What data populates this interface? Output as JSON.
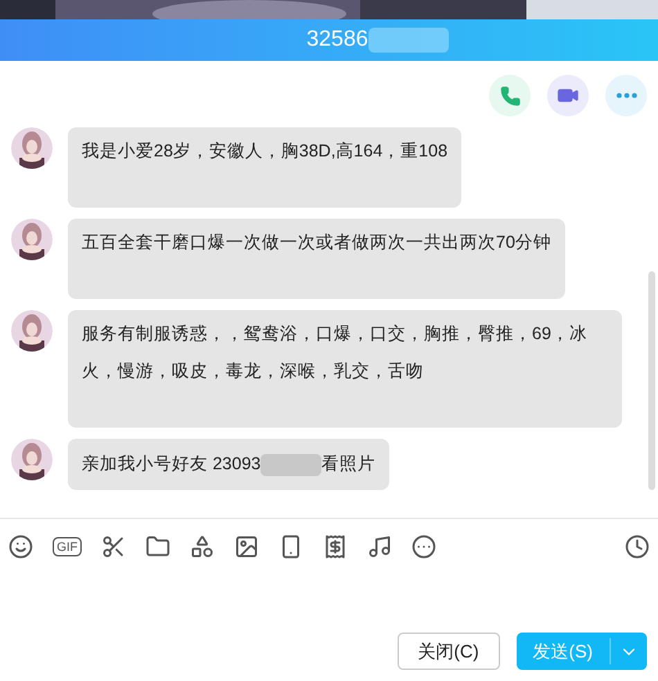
{
  "header": {
    "title": "32586"
  },
  "messages": [
    {
      "parts": [
        "我是小爱28岁，安徽人，胸38D,高164，重108"
      ],
      "redacted": false
    },
    {
      "parts": [
        "五百全套干磨口爆一次做一次或者做两次一共出两次70分钟"
      ],
      "redacted": false
    },
    {
      "parts": [
        "服务有制服诱惑，，鸳鸯浴，口爆，口交，胸推，臀推，69，冰火，慢游，吸皮，毒龙，深喉，乳交，舌吻"
      ],
      "redacted": false
    },
    {
      "parts": [
        "亲加我小号好友 23093",
        "看照片"
      ],
      "redacted": true
    }
  ],
  "toolbar": {
    "gif_label": "GIF"
  },
  "buttons": {
    "close": "关闭(C)",
    "send": "发送(S)"
  }
}
